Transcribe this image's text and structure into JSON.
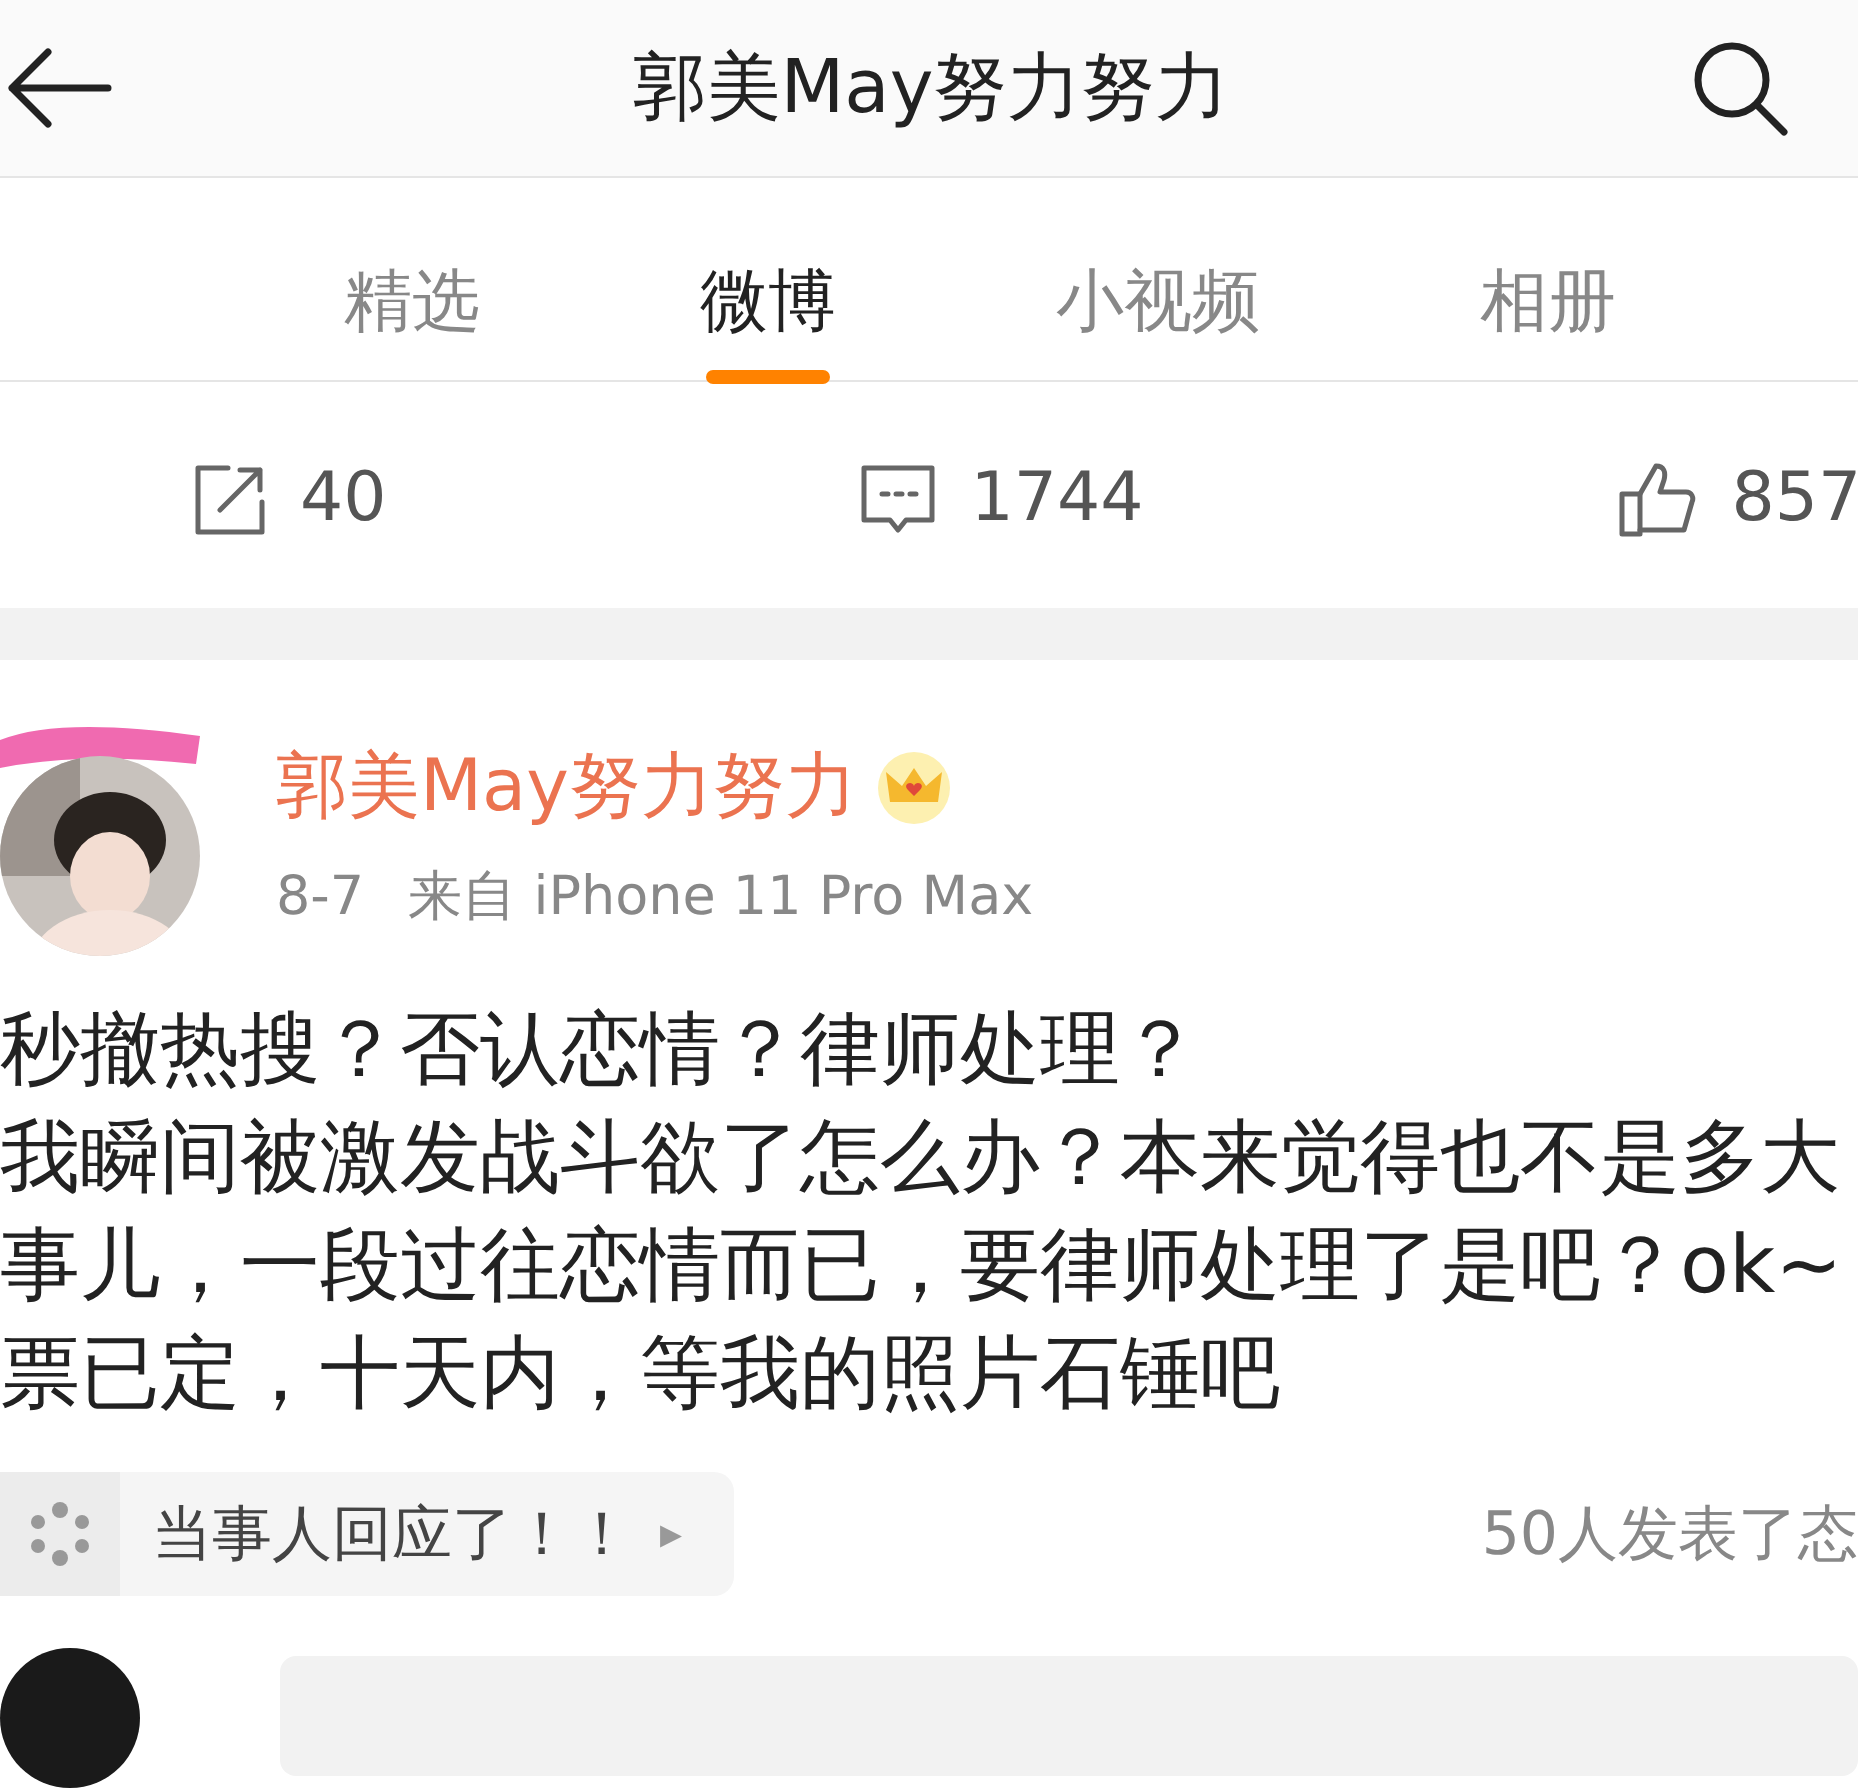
{
  "header": {
    "title": "郭美May努力努力"
  },
  "tabs": [
    {
      "label": "精选",
      "selected": false
    },
    {
      "label": "微博",
      "selected": true
    },
    {
      "label": "小视频",
      "selected": false
    },
    {
      "label": "相册",
      "selected": false
    }
  ],
  "stats": [
    {
      "kind": "repost",
      "count": "40"
    },
    {
      "kind": "comment",
      "count": "1744"
    },
    {
      "kind": "like",
      "count": "857"
    }
  ],
  "post": {
    "author": "郭美May努力努力",
    "date": "8-7",
    "source": "来自 iPhone 11 Pro Max",
    "lines": [
      "秒撤热搜？否认恋情？律师处理？",
      "我瞬间被激发战斗欲了怎么办？本来觉得也不是多大",
      "事儿，一段过往恋情而已，要律师处理了是吧？ok~",
      "票已定，十天内，等我的照片石锤吧"
    ],
    "topic": {
      "label": "当事人回应了！！",
      "caret": "▸"
    },
    "reactions": "50人发表了态"
  }
}
